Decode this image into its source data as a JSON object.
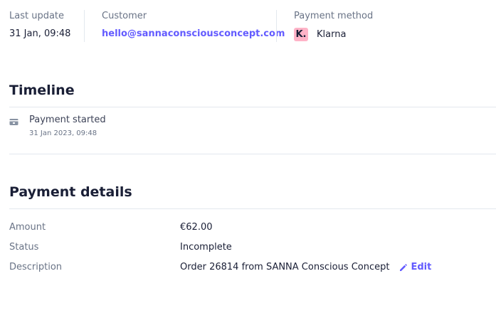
{
  "summary": {
    "last_update": {
      "label": "Last update",
      "value": "31 Jan, 09:48"
    },
    "customer": {
      "label": "Customer",
      "value": "hello@sannaconsciousconcept.com"
    },
    "payment_method": {
      "label": "Payment method",
      "logo_text": "K.",
      "logo_color": "#ffb3c7",
      "value": "Klarna",
      "icon": "klarna-logo"
    }
  },
  "timeline": {
    "title": "Timeline",
    "events": [
      {
        "icon": "card-icon",
        "title": "Payment started",
        "date": "31 Jan 2023, 09:48"
      }
    ]
  },
  "payment_details": {
    "title": "Payment details",
    "rows": [
      {
        "label": "Amount",
        "value": "€62.00"
      },
      {
        "label": "Status",
        "value": "Incomplete"
      },
      {
        "label": "Description",
        "value": "Order 26814 from SANNA Conscious Concept"
      }
    ],
    "edit_label": "Edit",
    "edit_icon": "pencil-icon"
  },
  "colors": {
    "accent": "#635bff",
    "text": "#1a1f36",
    "muted": "#697386",
    "divider": "#e3e8ee"
  }
}
